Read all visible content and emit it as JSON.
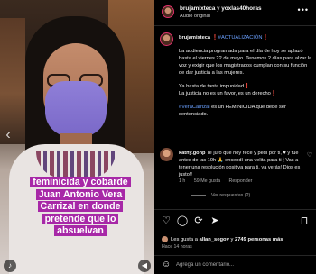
{
  "video": {
    "caption_lines": [
      "feminicida y cobarde",
      "Juan Antonio Vera",
      "Carrizal en donde",
      "pretende que lo",
      "absuelvan"
    ]
  },
  "header": {
    "username": "brujamixteca",
    "connector": "y",
    "coauthor": "yoxlas40horas",
    "audio": "Audio original",
    "more_glyph": "•••"
  },
  "post": {
    "username": "brujamixteca",
    "update_tag": "#ACTUALIZACIÓN",
    "p1": "La audiencia programada para el día de hoy se aplazó hasta el viernes 22 de mayo. Tenemos 2 días para alzar la voz y exigir que los magistrados cumplan con su función de dar justicia a las mujeres.",
    "p2_line1": "Ya basta de tanta impunidad",
    "p2_line2": "La justicia no es un favor, es un derecho",
    "hashtag": "#VeraCarrizal",
    "p3_rest": "es un FEMINICIDA que debe ser sentenciado."
  },
  "comment": {
    "username": "kathy.gonp",
    "text": "Te juro que hoy recé y pedí por ti, ♥ y fue antes de las 10h 🙏 encendí una velita para ti 🕯 Vas a tener una resolución positiva para ti, ya verás! Dios es justo!!",
    "time": "1 h",
    "likes": "59 Me gusta",
    "reply": "Responder",
    "view_replies": "Ver respuestas (2)"
  },
  "likes": {
    "prefix": "Les gusta a",
    "user": "allan_segov",
    "connector": "y",
    "count": "2749 personas más"
  },
  "time_ago": "Hace 14 horas",
  "comment_input": {
    "placeholder": "Agrega un comentario..."
  }
}
